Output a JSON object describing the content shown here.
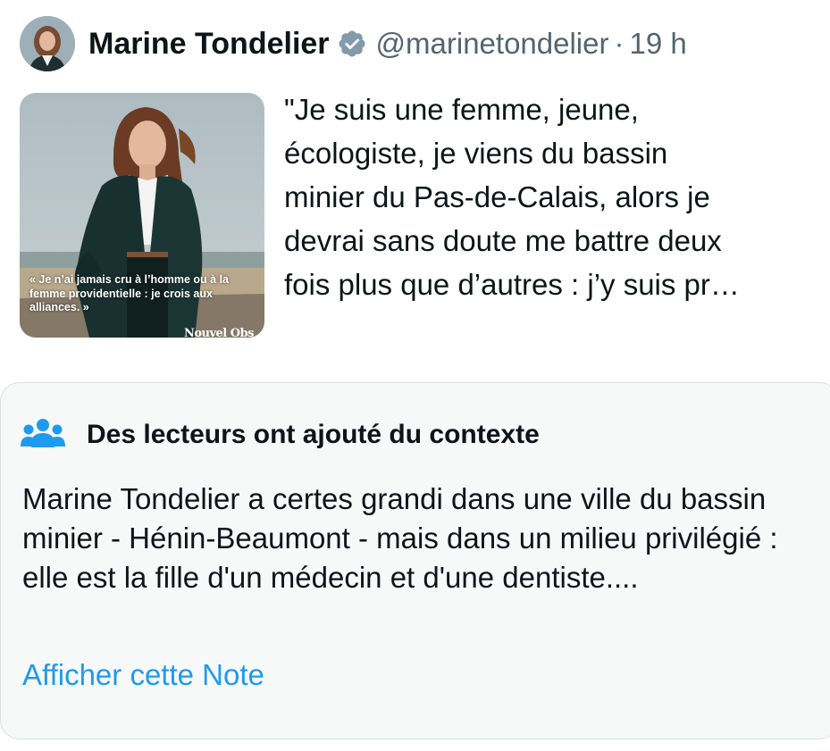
{
  "tweet": {
    "author_name": "Marine Tondelier",
    "handle": "@marinetondelier",
    "separator": "·",
    "time": "19 h",
    "text": "\"Je suis une femme, jeune,\nécologiste, je viens du bassin\nminier du Pas-de-Calais, alors je\ndevrai sans doute me battre deux\nfois plus que d’autres : j’y suis pr…",
    "media": {
      "quote": "« Je n’ai jamais cru à l’homme ou à la femme providentielle : je crois aux alliances. »",
      "logo": "Nouvel Obs"
    }
  },
  "community_note": {
    "icon": "people-icon",
    "title": "Des lecteurs ont ajouté du contexte",
    "body": "Marine Tondelier a certes grandi dans une ville du bassin minier - Hénin-Beaumont - mais dans un milieu privilégié : elle est la  fille d'un médecin et d'une dentiste....",
    "link_label": "Afficher cette Note"
  },
  "colors": {
    "text": "#0f1419",
    "secondary": "#536471",
    "link": "#1d9bf0",
    "note_background": "#f7f9f9",
    "note_icon": "#1d9bf0",
    "verified_badge": "#829aab"
  }
}
